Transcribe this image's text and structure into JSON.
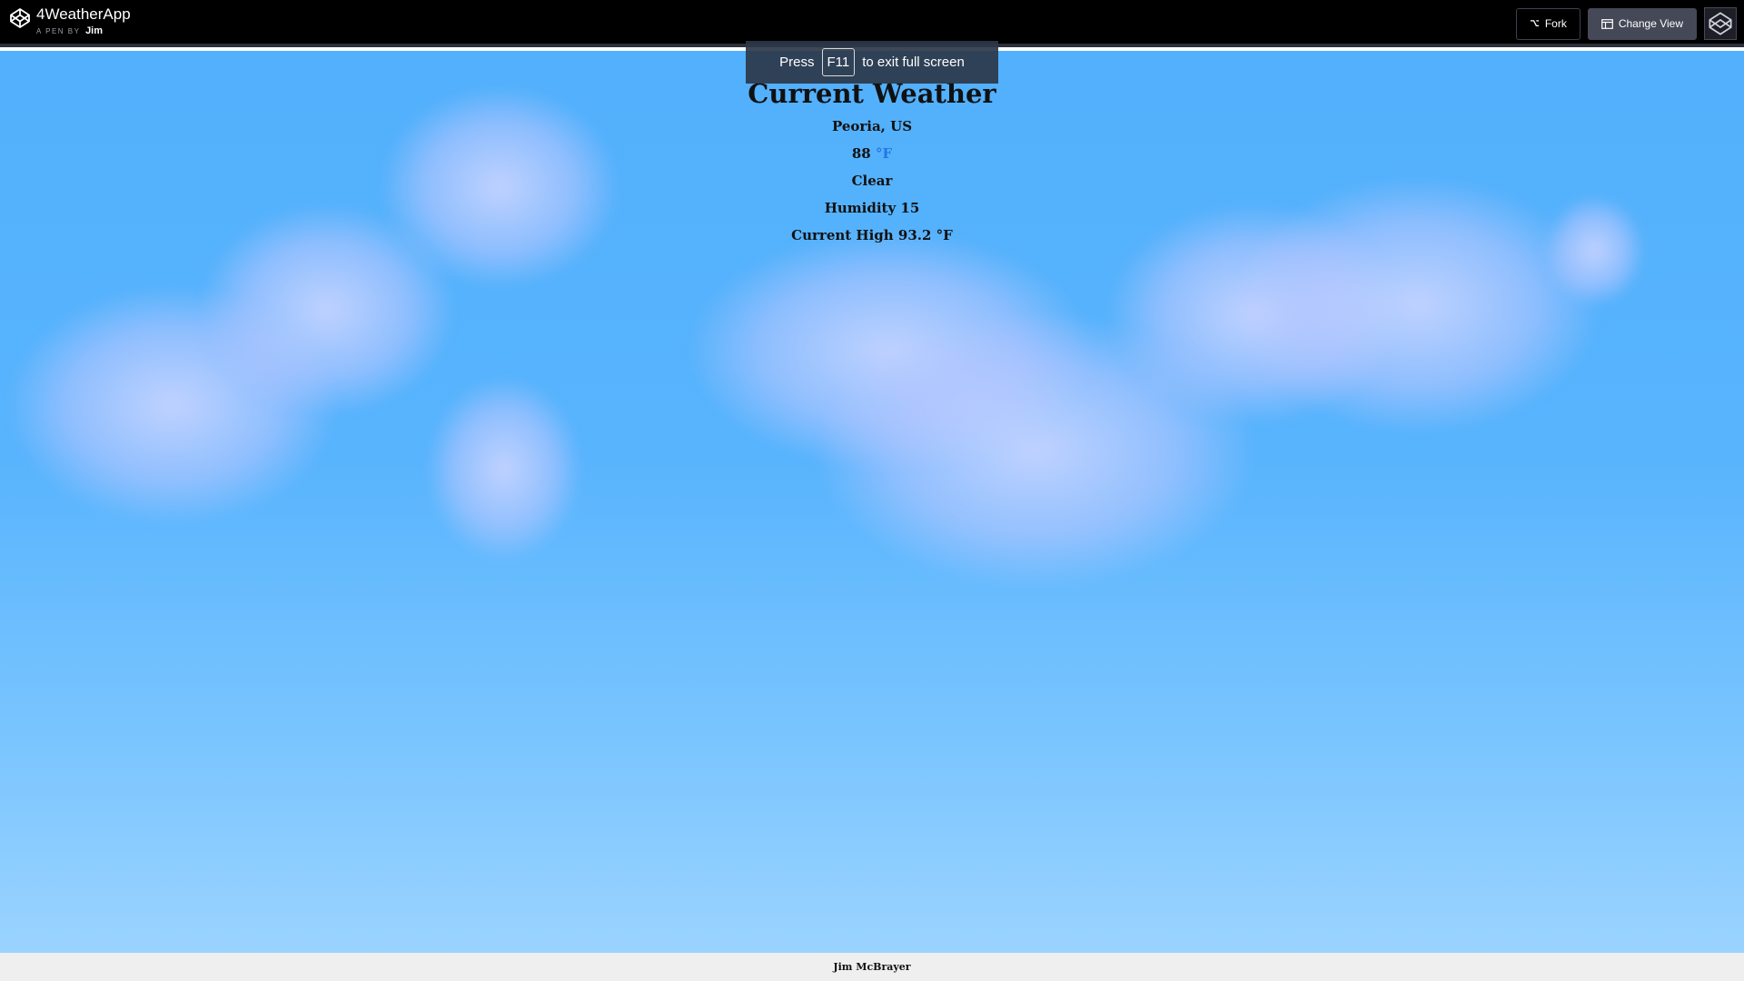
{
  "header": {
    "pen_title": "4WeatherApp",
    "byline_prefix": "A PEN BY",
    "author": "Jim",
    "fork_label": "Fork",
    "change_view_label": "Change View"
  },
  "toast": {
    "press": "Press",
    "key": "F11",
    "suffix": "to exit full screen"
  },
  "weather": {
    "heading": "Current Weather",
    "location": "Peoria, US",
    "temperature": "88",
    "unit": "°F",
    "condition": "Clear",
    "humidity": "Humidity 15",
    "current_high": "Current High 93.2 °F"
  },
  "footer": {
    "credit": "Jim McBrayer"
  },
  "colors": {
    "sky_top": "#52b0fc",
    "sky_bottom": "#9bd3ff",
    "unit_link": "#2575e0"
  }
}
